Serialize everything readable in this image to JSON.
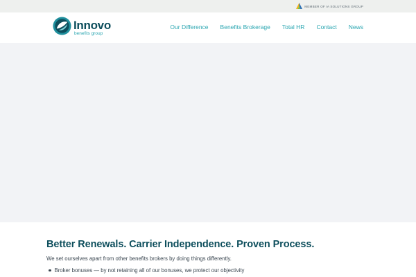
{
  "topbar": {
    "member_text": "MEMBER OF IA SOLUTIONS GROUP",
    "icon": "ia-solutions-logo-icon"
  },
  "header": {
    "logo": {
      "name": "Innovo",
      "subtitle": "benefits group",
      "icon": "innovo-logo-icon"
    },
    "nav": [
      {
        "label": "Our Difference"
      },
      {
        "label": "Benefits Brokerage"
      },
      {
        "label": "Total HR"
      },
      {
        "label": "Contact"
      },
      {
        "label": "News"
      }
    ]
  },
  "hero": {
    "background": "#f2f3f6"
  },
  "content": {
    "headline": "Better Renewals. Carrier Independence. Proven Process.",
    "intro": "We set ourselves apart from other benefits brokers by doing things differently.",
    "bullets": [
      {
        "text": "Broker bonuses — by not retaining all of our bonuses, we protect our objectivity"
      }
    ]
  },
  "colors": {
    "brand_dark": "#0d4e5c",
    "brand_teal": "#2aa6b1",
    "topbar_bg": "#eef0ee",
    "body_text": "#3a4650"
  }
}
